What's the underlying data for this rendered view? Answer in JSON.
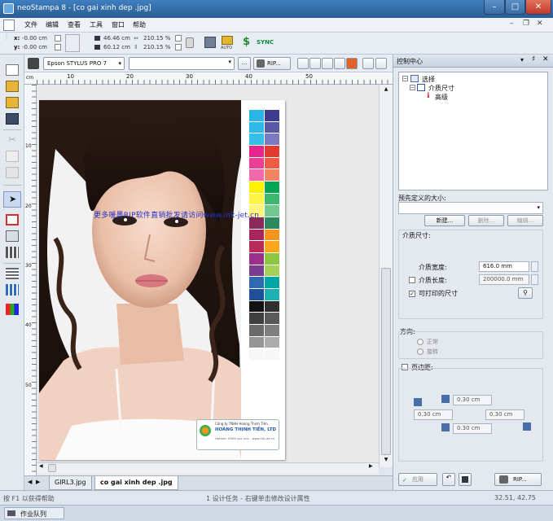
{
  "window": {
    "title": "neoStampa 8 - [co gai xinh dep .jpg]",
    "minimize": "–",
    "maximize": "□",
    "close": "✕"
  },
  "menu": [
    "文件",
    "编辑",
    "查看",
    "工具",
    "窗口",
    "帮助"
  ],
  "propbar": {
    "x_label": "x:",
    "y_label": "y:",
    "x_value": "-0.00 cm",
    "y_value": "-0.00 cm",
    "width_value": "46.46 cm",
    "height_value": "60.12 cm",
    "scale_w": "210.15 %",
    "scale_h": "210.15 %",
    "auto_label": "AUTO",
    "sync_label": "SYNC"
  },
  "doc_toolbar": {
    "printer": "Epson STYLUS PRO 7",
    "rip_button": "RIP...",
    "more_button": "..."
  },
  "ruler": {
    "unit": "cm",
    "h_ticks": [
      "10",
      "20",
      "30",
      "40",
      "50"
    ],
    "v_ticks": [
      "10",
      "20",
      "30",
      "40",
      "50"
    ]
  },
  "canvas": {
    "watermark": "更多喛墨RIP软件直销批发请访问www.ink-jet.cn",
    "swatch_colors": [
      [
        "#29b5e6",
        "#3d3b8f"
      ],
      [
        "#2fb9e8",
        "#5957a8"
      ],
      [
        "#35c0ea",
        "#7a78bf"
      ],
      [
        "#e5268a",
        "#e23a2f"
      ],
      [
        "#ea3f97",
        "#ec5d44"
      ],
      [
        "#f069ab",
        "#f28562"
      ],
      [
        "#fff200",
        "#00a651"
      ],
      [
        "#fff343",
        "#3bb86e"
      ],
      [
        "#fff57d",
        "#72c88e"
      ],
      [
        "#8a2a5b",
        "#2a8a5e"
      ],
      [
        "#a6275d",
        "#f7941d"
      ],
      [
        "#b72c5a",
        "#faa61a"
      ],
      [
        "#9b2f8e",
        "#8dc63f"
      ],
      [
        "#7b3b8f",
        "#a5d05a"
      ],
      [
        "#2d6ab0",
        "#00a6a6"
      ],
      [
        "#1f4f99",
        "#1db2b2"
      ],
      [
        "#111111",
        "#2f2f2f"
      ],
      [
        "#3f3f3f",
        "#595959"
      ],
      [
        "#6a6a6a",
        "#7f7f7f"
      ],
      [
        "#959595",
        "#ababab"
      ],
      [
        "#f7f7f7",
        "#f7f7f7"
      ]
    ],
    "logo_line1": "Công ty TNHH Hoàng Thịnh Tiến",
    "logo_line2": "HOÀNG THỊNH TIẾN, LTD",
    "logo_line3": "Hotline: 0909 xxx xxx - www.ink-jet.cn"
  },
  "tabs": [
    "GIRL3.jpg",
    "co gai xinh dep .jpg"
  ],
  "panel": {
    "title": "控制中心",
    "tree": [
      "选择",
      "介质尺寸",
      "高级"
    ],
    "predefined_label": "预先定义的大小:",
    "new_button": "新建...",
    "delete_button": "删除...",
    "edit_button": "编辑...",
    "media_group": "介质尺寸:",
    "media_width_label": "介质宽度:",
    "media_width_value": "616.0 mm",
    "media_length_label": "介质长度:",
    "media_length_value": "200000.0 mm",
    "printable_label": "可打印的尺寸",
    "direction_label": "方向:",
    "normal_label": "正常",
    "rotate_label": "旋转",
    "margins_label": "页边距:",
    "margin_top": "0.30 cm",
    "margin_left": "0.30 cm",
    "margin_right": "0.30 cm",
    "margin_bottom": "0.30 cm",
    "apply_button": "应用",
    "rip_button": "RIP..."
  },
  "status": {
    "help": "按 F1 以获得帮助",
    "info": "1 设计任务 - 右键单击修改设计属性",
    "coords": "32.51, 42.75",
    "queue": "作业队列"
  }
}
